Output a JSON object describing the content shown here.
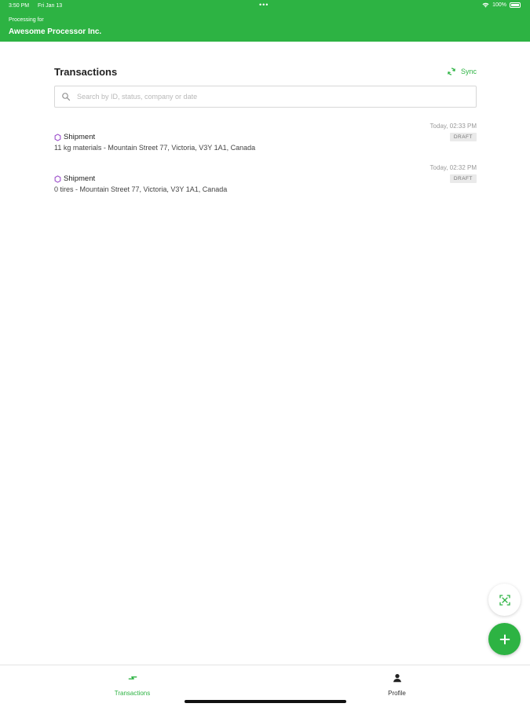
{
  "status_bar": {
    "time": "3:50 PM",
    "date": "Fri Jan 13",
    "dots": "•••",
    "battery": "100%"
  },
  "header": {
    "label": "Processing for",
    "company": "Awesome Processor Inc."
  },
  "page": {
    "title": "Transactions",
    "sync_label": "Sync"
  },
  "search": {
    "placeholder": "Search by ID, status, company or date",
    "value": ""
  },
  "transactions": [
    {
      "type": "Shipment",
      "description": "11 kg materials - Mountain Street 77, Victoria, V3Y 1A1, Canada",
      "time": "Today, 02:33 PM",
      "status": "DRAFT"
    },
    {
      "type": "Shipment",
      "description": "0 tires - Mountain Street 77, Victoria, V3Y 1A1, Canada",
      "time": "Today, 02:32 PM",
      "status": "DRAFT"
    }
  ],
  "fab": {
    "scan_icon": "scan-icon",
    "add_icon": "plus-icon"
  },
  "tabs": [
    {
      "label": "Transactions",
      "icon": "transactions-icon",
      "active": true
    },
    {
      "label": "Profile",
      "icon": "profile-icon",
      "active": false
    }
  ],
  "colors": {
    "brand_green": "#2db343",
    "shipment_icon": "#9b4dca",
    "badge_bg": "#eaeaea"
  }
}
